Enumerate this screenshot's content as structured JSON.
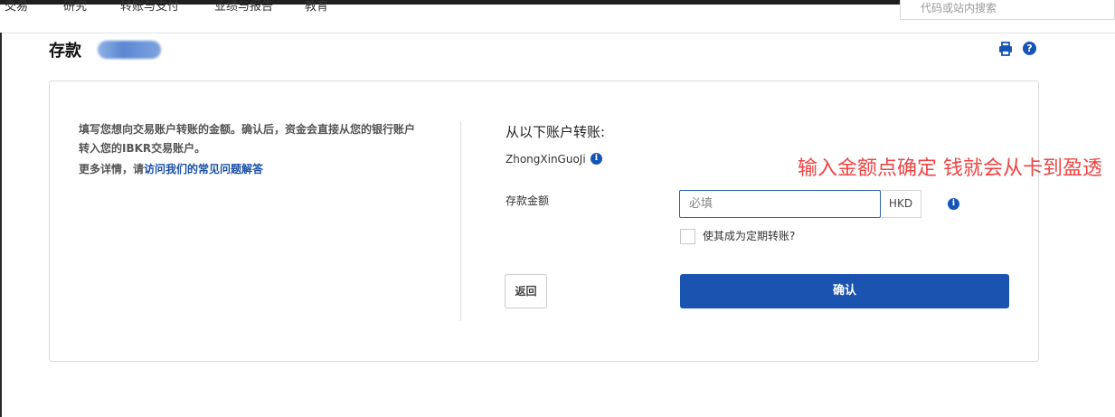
{
  "nav": {
    "items": [
      "交易",
      "研究",
      "转账与支付",
      "业绩与报告",
      "教育"
    ],
    "search_placeholder": "代码或站内搜索"
  },
  "page": {
    "title": "存款"
  },
  "intro": {
    "text": "填写您想向交易账户转账的金额。确认后，资金会直接从您的银行账户转入您的IBKR交易账户。",
    "more_prefix": "更多详情，请",
    "faq_link": "访问我们的常见问题解答"
  },
  "form": {
    "from_label": "从以下账户转账:",
    "account_name": "ZhongXinGuoJi",
    "amount_label": "存款金额",
    "amount_value": "",
    "amount_placeholder": "必填",
    "currency": "HKD",
    "recurring_label": "使其成为定期转账?",
    "back_label": "返回",
    "confirm_label": "确认"
  },
  "annotation": {
    "text": "输入金额点确定 钱就会从卡到盈透"
  },
  "icons": {
    "print": "print-icon",
    "help": "help-icon",
    "info": "info-icon"
  },
  "colors": {
    "primary": "#1b53b1",
    "link": "#1a4fa6",
    "annotation": "#ef4444",
    "input_border": "#2c5fa8"
  }
}
